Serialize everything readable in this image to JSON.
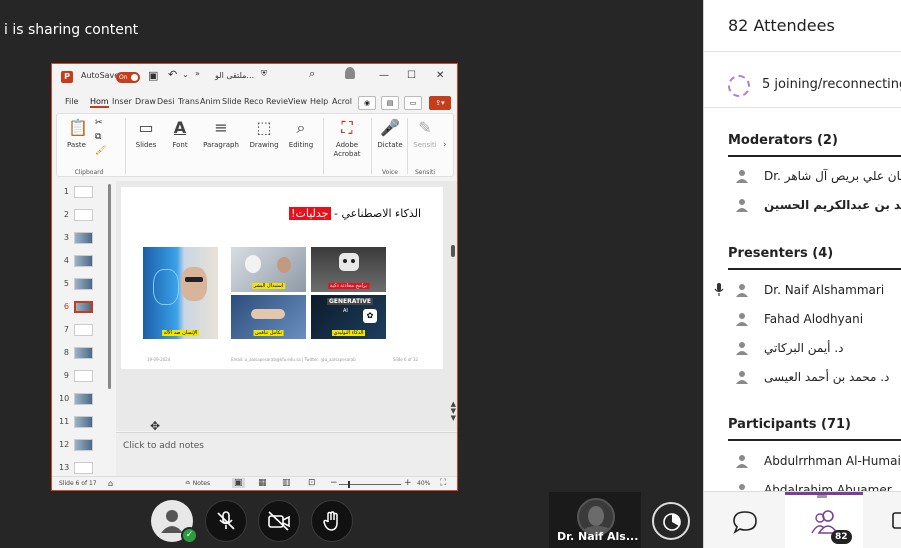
{
  "stage": {
    "share_text": "i is sharing content"
  },
  "ppt": {
    "autosave_label": "AutoSave",
    "autosave_state": "On",
    "file_title": "ملتقى الو...",
    "overflow_label": "»",
    "minimize": "—",
    "maximize": "☐",
    "close": "✕",
    "tabs": [
      "File",
      "Hom",
      "Inser",
      "Draw",
      "Desi",
      "Trans",
      "Anim",
      "Slide",
      "Reco",
      "Revie",
      "View",
      "Help",
      "Acrol"
    ],
    "ribbon": {
      "paste": "Paste",
      "clipboard": "Clipboard",
      "slides": "Slides",
      "font": "Font",
      "paragraph": "Paragraph",
      "drawing": "Drawing",
      "editing": "Editing",
      "adobe_acrobat": "Adobe Acrobat",
      "dictate": "Dictate",
      "voice": "Voice",
      "sensitivity": "Sensiti",
      "sensitivity_group": "Sensiti"
    },
    "thumb_numbers": [
      "1",
      "2",
      "3",
      "4",
      "5",
      "6",
      "7",
      "8",
      "9",
      "10",
      "11",
      "12",
      "13"
    ],
    "active_slide_index": 6,
    "slide": {
      "title_main": "الذكاء الاصطناعي - ",
      "title_highlight": "جدليات!",
      "captions": {
        "human_vs_ai": "الإنسان ضد الآلة",
        "future": "استبدال البشر",
        "robot_note": "برامج محادثة ذكية",
        "business": "تكامل تنافس",
        "generative_label": "GENERATIVE",
        "generative_sub": "AI",
        "generative_caption": "الذكاء التوليدي"
      },
      "footer_left": "19-09-2024",
      "footer_mid": "Email: a_aalsapesarab@kfu.edu.sa | Twitter: @a_aalsapesarab",
      "footer_right": "Slide 6 of 32"
    },
    "notes_placeholder": "Click to add notes",
    "status": {
      "slide_counter": "Slide 6 of 17",
      "notes_label": "Notes",
      "zoom_level": "40%",
      "zoom_minus": "−",
      "zoom_plus": "+",
      "zoom_fraction": 0.15
    }
  },
  "meeting_controls": {
    "video_name": "Dr. Naif Als...",
    "status_check": "✓"
  },
  "panel": {
    "title": "82 Attendees",
    "joining": "5 joining/reconnecting",
    "moderators": {
      "heading": "Moderators (2)",
      "people": [
        "Dr. حنان علي بريص آل شاهر",
        "د. أحمد بن عبدالكريم الحسين"
      ]
    },
    "presenters": {
      "heading": "Presenters (4)",
      "people": [
        "Dr. Naif Alshammari",
        "Fahad Alodhyani",
        "د. أيمن البركاتي",
        "د. محمد بن أحمد العيسى"
      ]
    },
    "participants": {
      "heading": "Participants (71)",
      "people": [
        "Abdulrrhman Al-Humaidi",
        "Abdalrahim Abuamer"
      ]
    },
    "attendee_count_badge": "82"
  },
  "colors": {
    "ppt_accent": "#c43e1c",
    "panel_accent": "#7b3f98",
    "status_green": "#2a9d3e"
  }
}
